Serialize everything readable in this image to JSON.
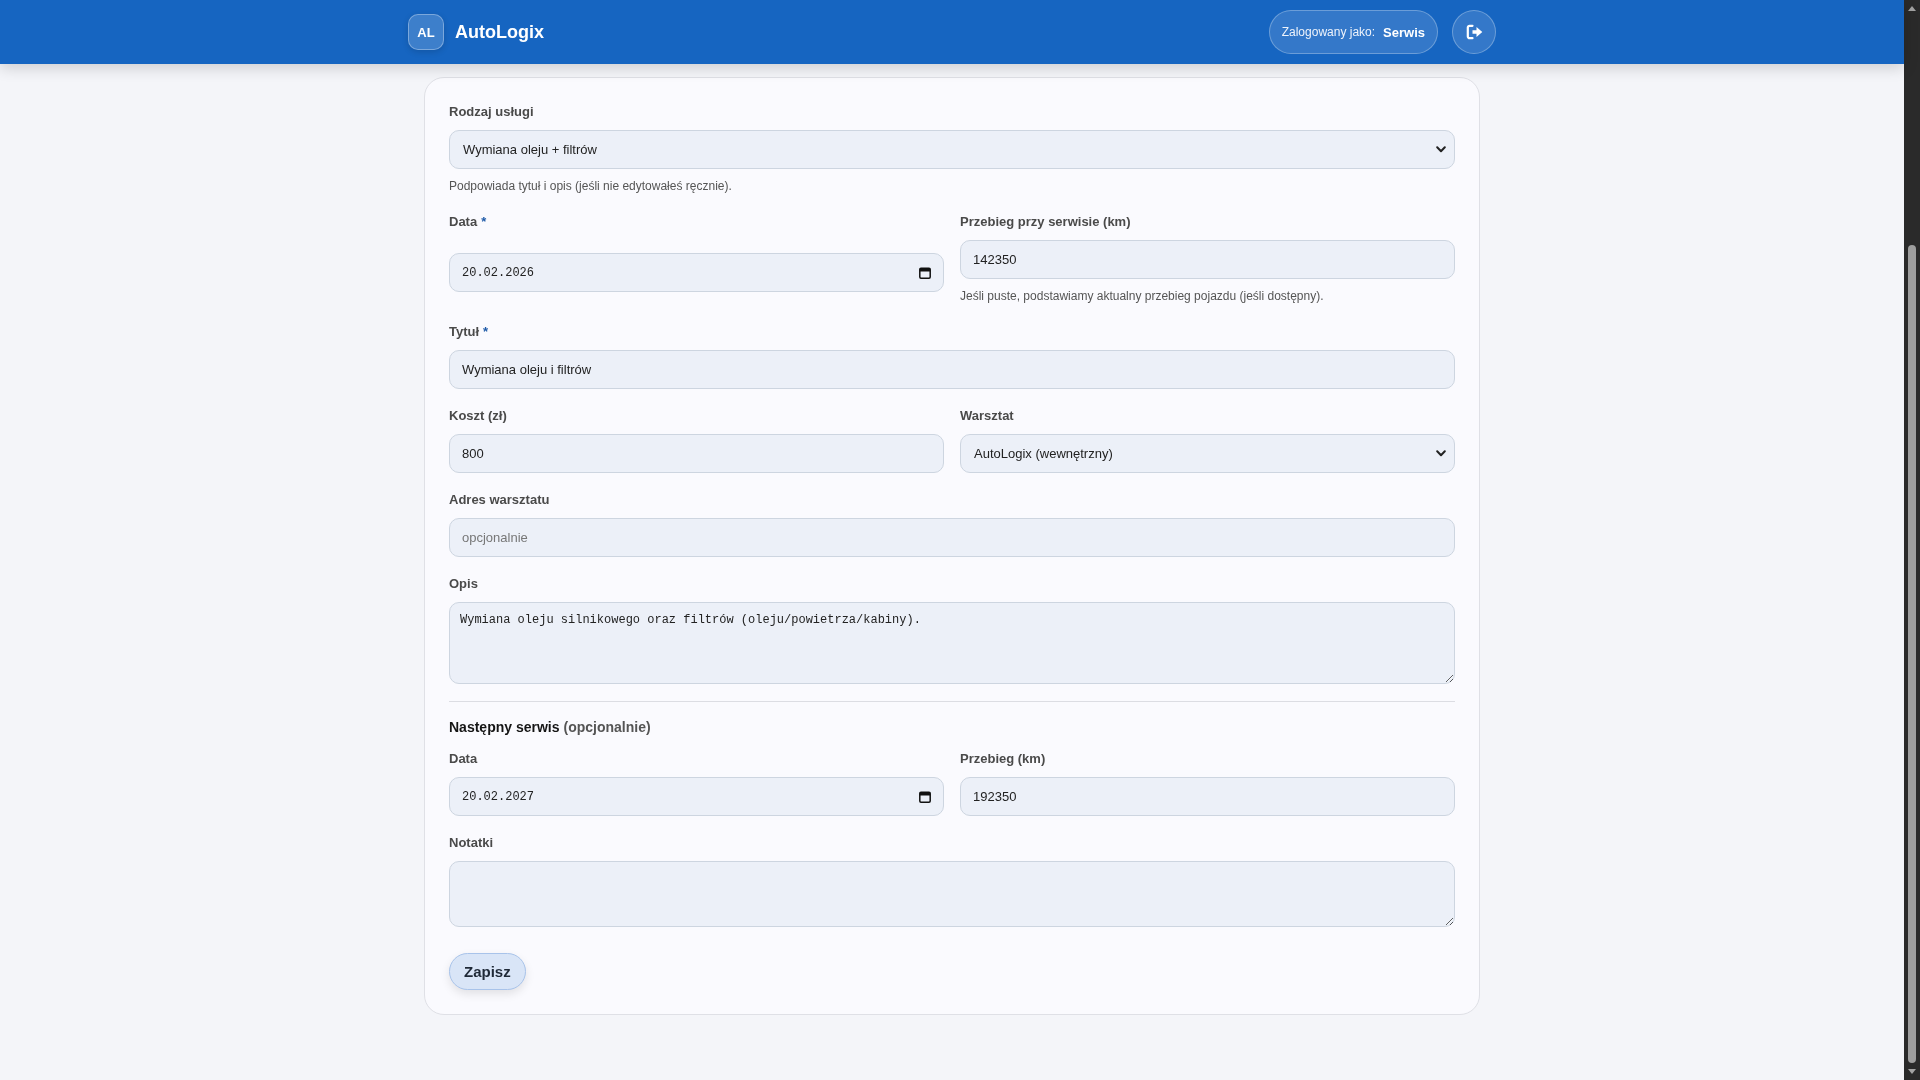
{
  "header": {
    "logo": "AL",
    "app_name": "AutoLogix",
    "user_label": "Zalogowany jako:",
    "user_name": "Serwis"
  },
  "form": {
    "rows": [
      [
        {
          "kind": "select",
          "label": "Rodzaj usługi",
          "value": "Wymiana oleju + filtrów",
          "hint": "Podpowiada tytuł i opis (jeśli nie edytowałeś ręcznie)."
        }
      ],
      [
        {
          "kind": "date",
          "label": "Data",
          "required_mark": "*",
          "value": "20.02.2026"
        },
        {
          "kind": "text",
          "label": "Przebieg przy serwisie (km)",
          "value": "142350",
          "hint": "Jeśli puste, podstawiamy aktualny przebieg pojazdu (jeśli dostępny)."
        }
      ],
      [
        {
          "kind": "text",
          "label": "Tytuł",
          "required_mark": "*",
          "value": "Wymiana oleju i filtrów"
        }
      ],
      [
        {
          "kind": "text",
          "label": "Koszt (zł)",
          "value": "800"
        },
        {
          "kind": "select",
          "label": "Warsztat",
          "value": "AutoLogix (wewnętrzny)"
        }
      ],
      [
        {
          "kind": "text",
          "label": "Adres warsztatu",
          "placeholder": "opcjonalnie"
        }
      ],
      [
        {
          "kind": "textarea",
          "label": "Opis",
          "value": "Wymiana oleju silnikowego oraz filtrów (oleju/powietrza/kabiny)."
        }
      ]
    ],
    "next_service": {
      "title": "Następny serwis",
      "note": "(opcjonalnie)",
      "rows": [
        [
          {
            "kind": "date",
            "label": "Data",
            "value": "20.02.2027"
          },
          {
            "kind": "text",
            "label": "Przebieg (km)",
            "value": "192350"
          }
        ],
        [
          {
            "kind": "textarea",
            "label": "Notatki"
          }
        ]
      ]
    },
    "submit": "Zapisz"
  }
}
